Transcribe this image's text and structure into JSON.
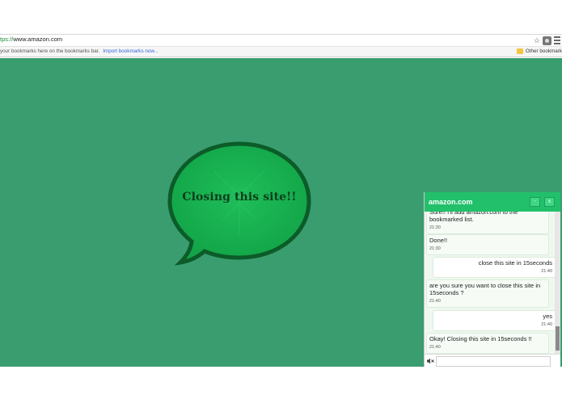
{
  "browser": {
    "url_scheme": "tps://",
    "url_host": "www.amazon.com",
    "bookmarks_hint": "your bookmarks here on the bookmarks bar.",
    "import_link": "Import bookmarks now...",
    "other_bookmarks": "Other bookmark"
  },
  "page": {
    "background_color": "#3a9d6f",
    "bubble_text": "Closing this site!!"
  },
  "chat": {
    "title": "amazon.com",
    "minimize_label": "-",
    "close_label": "x",
    "header_color": "#22c06b",
    "messages": [
      {
        "from": "bot",
        "text": "Sure!! I'll add amazon.com to the bookmarked list.",
        "time": "21:30"
      },
      {
        "from": "bot",
        "text": "Done!!",
        "time": "21:30"
      },
      {
        "from": "user",
        "text": "close this site in 15seconds",
        "time": "21:40"
      },
      {
        "from": "bot",
        "text": "are you sure you want to close this site in 15seconds ?",
        "time": "21:40"
      },
      {
        "from": "user",
        "text": "yes",
        "time": "21:40"
      },
      {
        "from": "bot",
        "text": "Okay! Closing this site in 15seconds !!",
        "time": "21:40"
      }
    ],
    "input_value": ""
  }
}
